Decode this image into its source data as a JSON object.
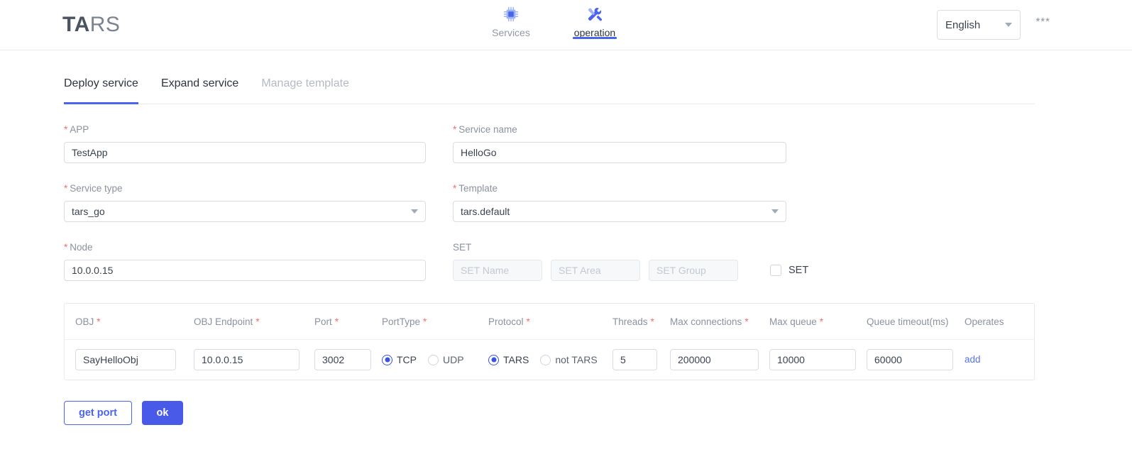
{
  "header": {
    "logo_bold": "TA",
    "logo_light": "RS",
    "nav": [
      {
        "label": "Services",
        "icon": "cpu-chip-icon",
        "active": false
      },
      {
        "label": "operation",
        "icon": "wrench-tools-icon",
        "active": true
      }
    ],
    "language": {
      "value": "English",
      "icon": "chevron-down-icon"
    },
    "more": "***"
  },
  "tabs": [
    {
      "label": "Deploy service",
      "state": "active"
    },
    {
      "label": "Expand service",
      "state": "inactive"
    },
    {
      "label": "Manage template",
      "state": "disabled"
    }
  ],
  "form": {
    "app": {
      "label": "APP",
      "required": true,
      "value": "TestApp"
    },
    "service_name": {
      "label": "Service name",
      "required": true,
      "value": "HelloGo"
    },
    "service_type": {
      "label": "Service type",
      "required": true,
      "value": "tars_go"
    },
    "template": {
      "label": "Template",
      "required": true,
      "value": "tars.default"
    },
    "node": {
      "label": "Node",
      "required": true,
      "value": "10.0.0.15"
    },
    "set": {
      "label": "SET",
      "required": false,
      "name_placeholder": "SET Name",
      "area_placeholder": "SET Area",
      "group_placeholder": "SET Group",
      "checkbox_label": "SET",
      "checked": false
    }
  },
  "table": {
    "headers": [
      {
        "label": "OBJ",
        "required": true
      },
      {
        "label": "OBJ Endpoint",
        "required": true
      },
      {
        "label": "Port",
        "required": true
      },
      {
        "label": "PortType",
        "required": true
      },
      {
        "label": "Protocol",
        "required": true
      },
      {
        "label": "Threads",
        "required": true
      },
      {
        "label": "Max connections",
        "required": true
      },
      {
        "label": "Max queue",
        "required": true
      },
      {
        "label": "Queue timeout(ms)",
        "required": false
      },
      {
        "label": "Operates",
        "required": false
      }
    ],
    "row": {
      "obj": "SayHelloObj",
      "obj_endpoint": "10.0.0.15",
      "port": "3002",
      "port_type": {
        "options": [
          "TCP",
          "UDP"
        ],
        "selected": "TCP"
      },
      "protocol": {
        "options": [
          "TARS",
          "not TARS"
        ],
        "selected": "TARS"
      },
      "threads": "5",
      "max_connections": "200000",
      "max_queue": "10000",
      "queue_timeout": "60000",
      "operate_link": "add"
    }
  },
  "actions": {
    "get_port": "get port",
    "ok": "ok"
  },
  "colors": {
    "accent_blue": "#4a64f0",
    "primary_button": "#4a5ae8",
    "required_red": "#f56c6c",
    "link_blue": "#5a72ee",
    "label_gray": "#8a929e"
  }
}
